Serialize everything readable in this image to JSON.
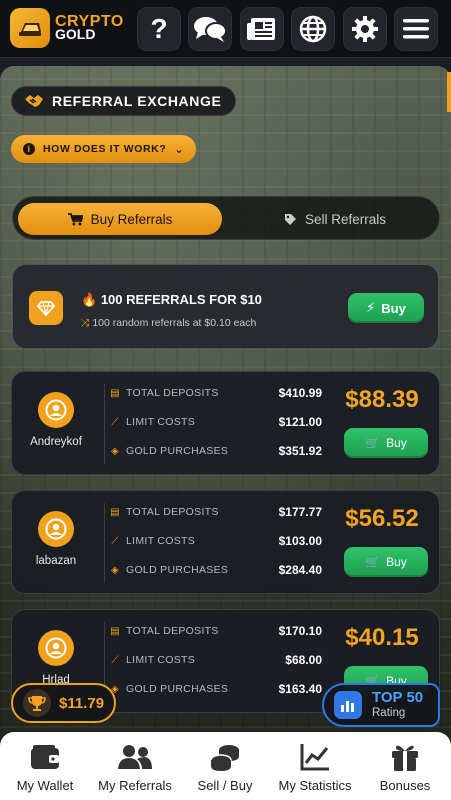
{
  "brand": {
    "line1": "CRYPTO",
    "line2": "GOLD"
  },
  "topbar": {
    "buttons": [
      "help-icon",
      "chat-icon",
      "news-icon",
      "globe-icon",
      "gear-icon",
      "menu-icon"
    ]
  },
  "section": {
    "title": "REFERRAL EXCHANGE",
    "how_label": "HOW DOES IT WORK?"
  },
  "tabs": {
    "buy": "Buy Referrals",
    "sell": "Sell Referrals"
  },
  "offer": {
    "title": "100 REFERRALS FOR $10",
    "subtitle": "100 random referrals at $0.10 each",
    "buy_label": "Buy"
  },
  "row_labels": {
    "deposits": "TOTAL DEPOSITS",
    "limit": "LIMIT COSTS",
    "gold": "GOLD PURCHASES"
  },
  "referrals": [
    {
      "name": "Andreykof",
      "total_deposits": "$410.99",
      "limit_costs": "$121.00",
      "gold_purchases": "$351.92",
      "price": "$88.39",
      "buy_label": "Buy"
    },
    {
      "name": "labazan",
      "total_deposits": "$177.77",
      "limit_costs": "$103.00",
      "gold_purchases": "$284.40",
      "price": "$56.52",
      "buy_label": "Buy"
    },
    {
      "name": "Hrlad",
      "total_deposits": "$170.10",
      "limit_costs": "$68.00",
      "gold_purchases": "$163.40",
      "price": "$40.15",
      "buy_label": "Buy"
    }
  ],
  "balance": {
    "amount": "$11.79"
  },
  "rating": {
    "title": "TOP 50",
    "subtitle": "Rating"
  },
  "bottom_nav": [
    {
      "label": "My Wallet",
      "icon": "wallet-icon"
    },
    {
      "label": "My Referrals",
      "icon": "users-icon"
    },
    {
      "label": "Sell / Buy",
      "icon": "coins-icon"
    },
    {
      "label": "My Statistics",
      "icon": "chart-icon"
    },
    {
      "label": "Bonuses",
      "icon": "gift-icon"
    }
  ],
  "colors": {
    "accent": "#f0a11e",
    "buy_green": "#2fc26a",
    "rating_blue": "#2f78e6"
  }
}
